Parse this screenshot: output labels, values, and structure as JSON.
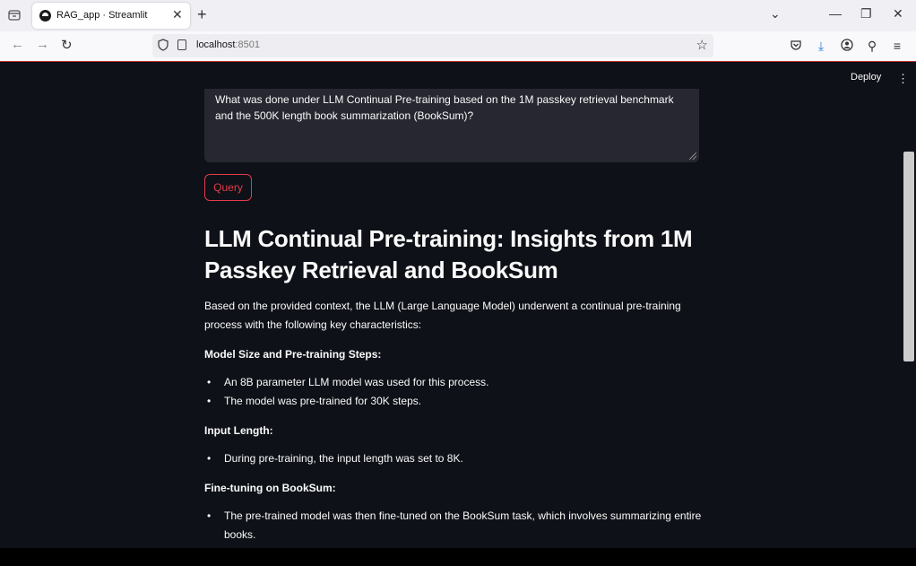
{
  "browser": {
    "tab_title": "RAG_app · Streamlit",
    "url_host": "localhost",
    "url_port": ":8501"
  },
  "app": {
    "deploy_label": "Deploy",
    "question_text": "What was done under LLM Continual Pre-training based on the 1M passkey retrieval benchmark and the 500K length book summarization (BookSum)?",
    "query_button": "Query",
    "answer": {
      "heading": "LLM Continual Pre-training: Insights from 1M Passkey Retrieval and BookSum",
      "intro": "Based on the provided context, the LLM (Large Language Model) underwent a continual pre-training process with the following key characteristics:",
      "sections": [
        {
          "title": "Model Size and Pre-training Steps:",
          "bullets": [
            "An 8B parameter LLM model was used for this process.",
            "The model was pre-trained for 30K steps."
          ]
        },
        {
          "title": "Input Length:",
          "bullets": [
            "During pre-training, the input length was set to 8K."
          ]
        },
        {
          "title": "Fine-tuning on BookSum:",
          "bullets": [
            "The pre-trained model was then fine-tuned on the BookSum task, which involves summarizing entire books."
          ]
        }
      ]
    }
  }
}
